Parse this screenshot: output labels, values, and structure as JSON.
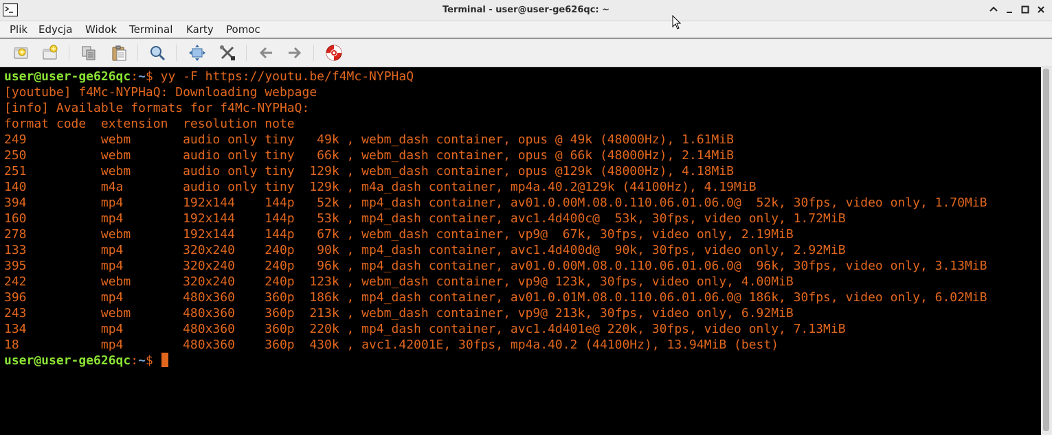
{
  "window": {
    "title": "Terminal - user@user-ge626qc: ~"
  },
  "menu": [
    "Plik",
    "Edycja",
    "Widok",
    "Terminal",
    "Karty",
    "Pomoc"
  ],
  "toolbar": {
    "icons": [
      "new-tab-icon",
      "new-window-icon",
      "copy-icon",
      "paste-icon",
      "search-icon",
      "fullscreen-icon",
      "preferences-icon",
      "previous-tab-icon",
      "next-tab-icon",
      "help-icon"
    ]
  },
  "colors": {
    "terminal_bg": "#000000",
    "text": "#e2671e",
    "prompt_user": "#8ae234",
    "prompt_path": "#729fcf"
  },
  "terminal": {
    "prompt_user": "user@user-ge626qc",
    "prompt_sep": ":",
    "prompt_path": "~",
    "prompt_symbol": "$ ",
    "command": "yy -F https://youtu.be/f4Mc-NYPHaQ",
    "output": [
      "[youtube] f4Mc-NYPHaQ: Downloading webpage",
      "[info] Available formats for f4Mc-NYPHaQ:",
      "format code  extension  resolution note",
      "249          webm       audio only tiny   49k , webm_dash container, opus @ 49k (48000Hz), 1.61MiB",
      "250          webm       audio only tiny   66k , webm_dash container, opus @ 66k (48000Hz), 2.14MiB",
      "251          webm       audio only tiny  129k , webm_dash container, opus @129k (48000Hz), 4.18MiB",
      "140          m4a        audio only tiny  129k , m4a_dash container, mp4a.40.2@129k (44100Hz), 4.19MiB",
      "394          mp4        192x144    144p   52k , mp4_dash container, av01.0.00M.08.0.110.06.01.06.0@  52k, 30fps, video only, 1.70MiB",
      "160          mp4        192x144    144p   53k , mp4_dash container, avc1.4d400c@  53k, 30fps, video only, 1.72MiB",
      "278          webm       192x144    144p   67k , webm_dash container, vp9@  67k, 30fps, video only, 2.19MiB",
      "133          mp4        320x240    240p   90k , mp4_dash container, avc1.4d400d@  90k, 30fps, video only, 2.92MiB",
      "395          mp4        320x240    240p   96k , mp4_dash container, av01.0.00M.08.0.110.06.01.06.0@  96k, 30fps, video only, 3.13MiB",
      "242          webm       320x240    240p  123k , webm_dash container, vp9@ 123k, 30fps, video only, 4.00MiB",
      "396          mp4        480x360    360p  186k , mp4_dash container, av01.0.01M.08.0.110.06.01.06.0@ 186k, 30fps, video only, 6.02MiB",
      "243          webm       480x360    360p  213k , webm_dash container, vp9@ 213k, 30fps, video only, 6.92MiB",
      "134          mp4        480x360    360p  220k , mp4_dash container, avc1.4d401e@ 220k, 30fps, video only, 7.13MiB",
      "18           mp4        480x360    360p  430k , avc1.42001E, 30fps, mp4a.40.2 (44100Hz), 13.94MiB (best)"
    ]
  }
}
